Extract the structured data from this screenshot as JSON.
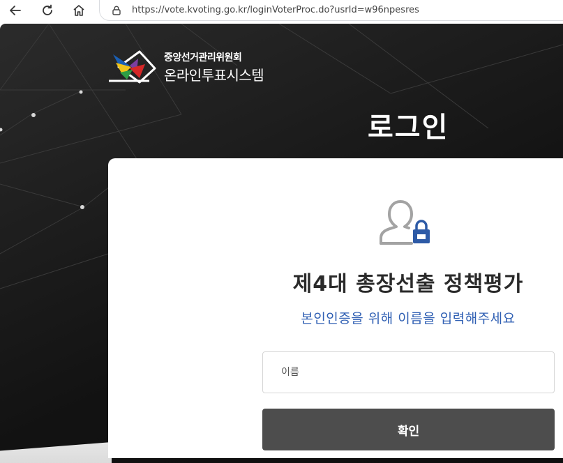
{
  "browser": {
    "url": "https://vote.kvoting.go.kr/loginVoterProc.do?usrId=w96npesres",
    "icons": [
      "back-arrow-icon",
      "reload-icon",
      "home-icon",
      "lock-icon"
    ]
  },
  "header": {
    "org_name": "중앙선거관리위원회",
    "system_name": "온라인투표시스템",
    "page_heading": "로그인"
  },
  "login": {
    "election_title": "제4대 총장선출 정책평가",
    "instruction": "본인인증을 위해 이름을 입력해주세요",
    "name_value": "",
    "name_placeholder": "이름",
    "confirm_label": "확인"
  },
  "colors": {
    "instruction": "#2f5fb3",
    "button_bg": "#4d4d4d",
    "lock_accent": "#2d5aa6",
    "page_bg": "#141414"
  }
}
